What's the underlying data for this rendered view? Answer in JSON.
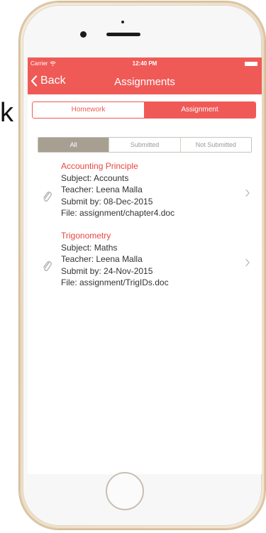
{
  "side_text": "k",
  "status_bar": {
    "carrier": "Carrier",
    "time": "12:40 PM"
  },
  "nav": {
    "back_label": "Back",
    "title": "Assignments"
  },
  "main_tabs": [
    {
      "label": "Homework",
      "active": false
    },
    {
      "label": "Assignment",
      "active": true
    }
  ],
  "filter_tabs": [
    {
      "label": "All",
      "active": true
    },
    {
      "label": "Submitted",
      "active": false
    },
    {
      "label": "Not Submitted",
      "active": false
    }
  ],
  "assignments": [
    {
      "title": "Accounting Principle",
      "subject": "Subject: Accounts",
      "teacher": "Teacher: Leena Malla",
      "submit_by": "Submit by: 08-Dec-2015",
      "file": "File: assignment/chapter4.doc"
    },
    {
      "title": "Trigonometry",
      "subject": "Subject: Maths",
      "teacher": "Teacher: Leena Malla",
      "submit_by": "Submit by: 24-Nov-2015",
      "file": "File: assignment/TrigIDs.doc"
    }
  ],
  "colors": {
    "accent": "#ef5a57",
    "title_red": "#e8453f",
    "filter_active": "#a89f93"
  },
  "icons": {
    "wifi": "wifi-icon",
    "battery": "battery-icon",
    "back": "chevron-left-icon",
    "attachment": "paperclip-icon",
    "disclosure": "chevron-right-icon"
  }
}
